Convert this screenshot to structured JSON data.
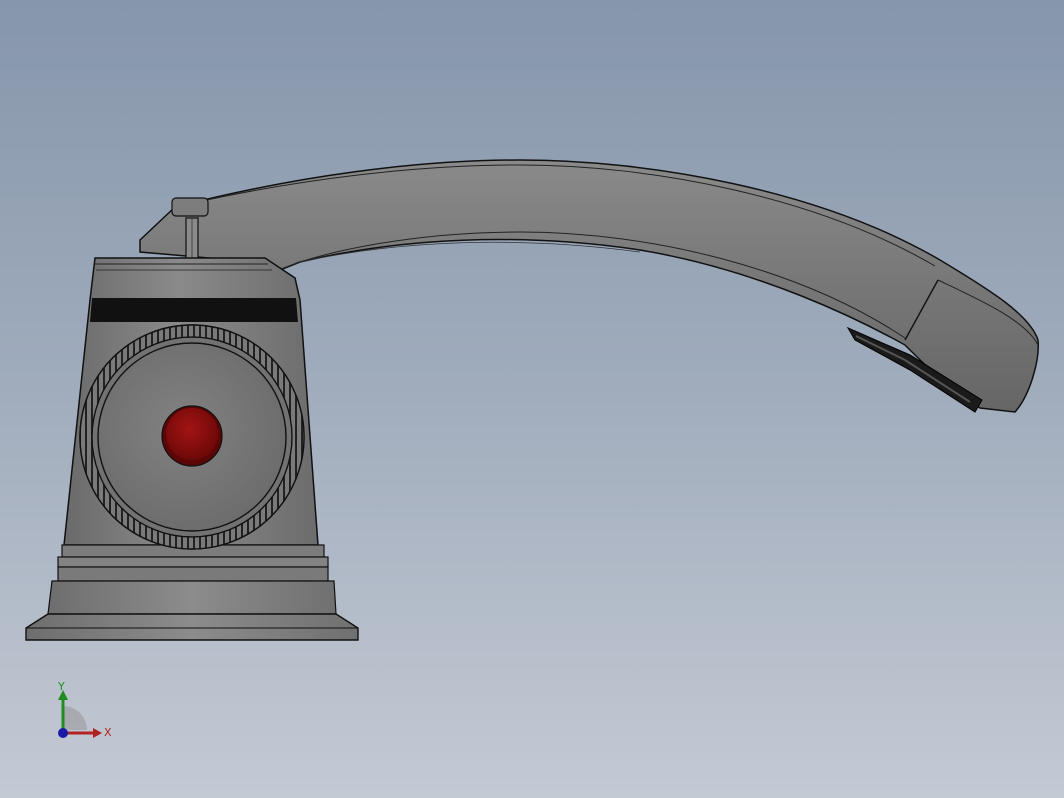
{
  "viewport": {
    "background_top": "#8696ab",
    "background_bottom": "#c4cad4"
  },
  "model": {
    "name": "faucet",
    "body_color": "#7a7a7a",
    "outline_color": "#111111",
    "indicator_color": "#8b0d0d"
  },
  "triad": {
    "x_label": "X",
    "y_label": "Y",
    "x_color": "#b22222",
    "y_color": "#228b22",
    "z_color": "#1a1aa8"
  }
}
